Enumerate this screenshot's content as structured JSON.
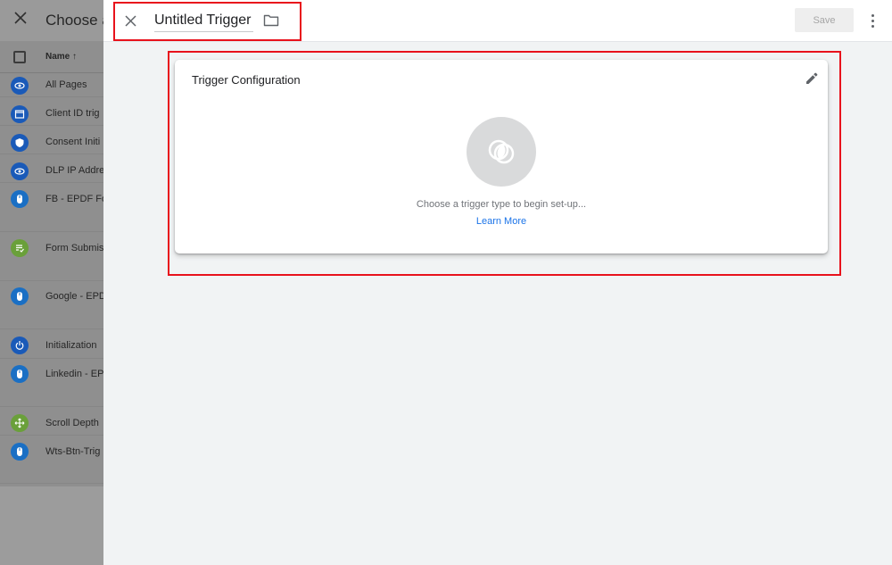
{
  "background_panel": {
    "title": "Choose a",
    "column_header": "Name ↑",
    "rows": [
      {
        "label": "All Pages",
        "icon": "eye-icon",
        "color": "#1a5ab8"
      },
      {
        "label": "Client ID trig",
        "icon": "window-icon",
        "color": "#1a5ab8"
      },
      {
        "label": "Consent Initi",
        "icon": "shield-icon",
        "color": "#1a5ab8"
      },
      {
        "label": "DLP IP Addre",
        "icon": "eye-icon",
        "color": "#1a5ab8"
      },
      {
        "label": "FB - EPDF Fo",
        "icon": "mouse-icon",
        "color": "#1a6fc4"
      },
      {
        "label": "Form Submis",
        "icon": "form-icon",
        "color": "#6aa03a"
      },
      {
        "label": "Google - EPD",
        "icon": "mouse-icon",
        "color": "#1a6fc4"
      },
      {
        "label": "Initialization",
        "icon": "power-icon",
        "color": "#1a5ab8"
      },
      {
        "label": "Linkedin - EP",
        "icon": "mouse-icon",
        "color": "#1a6fc4"
      },
      {
        "label": "Scroll Depth",
        "icon": "move-icon",
        "color": "#6aa03a"
      },
      {
        "label": "Wts-Btn-Trig",
        "icon": "mouse-icon",
        "color": "#1a6fc4"
      }
    ]
  },
  "editor": {
    "trigger_name": "Untitled Trigger",
    "save_label": "Save",
    "card": {
      "title": "Trigger Configuration",
      "hint": "Choose a trigger type to begin set-up...",
      "learn_more": "Learn More"
    }
  },
  "colors": {
    "highlight": "#e8121c",
    "link": "#1a73e8"
  }
}
